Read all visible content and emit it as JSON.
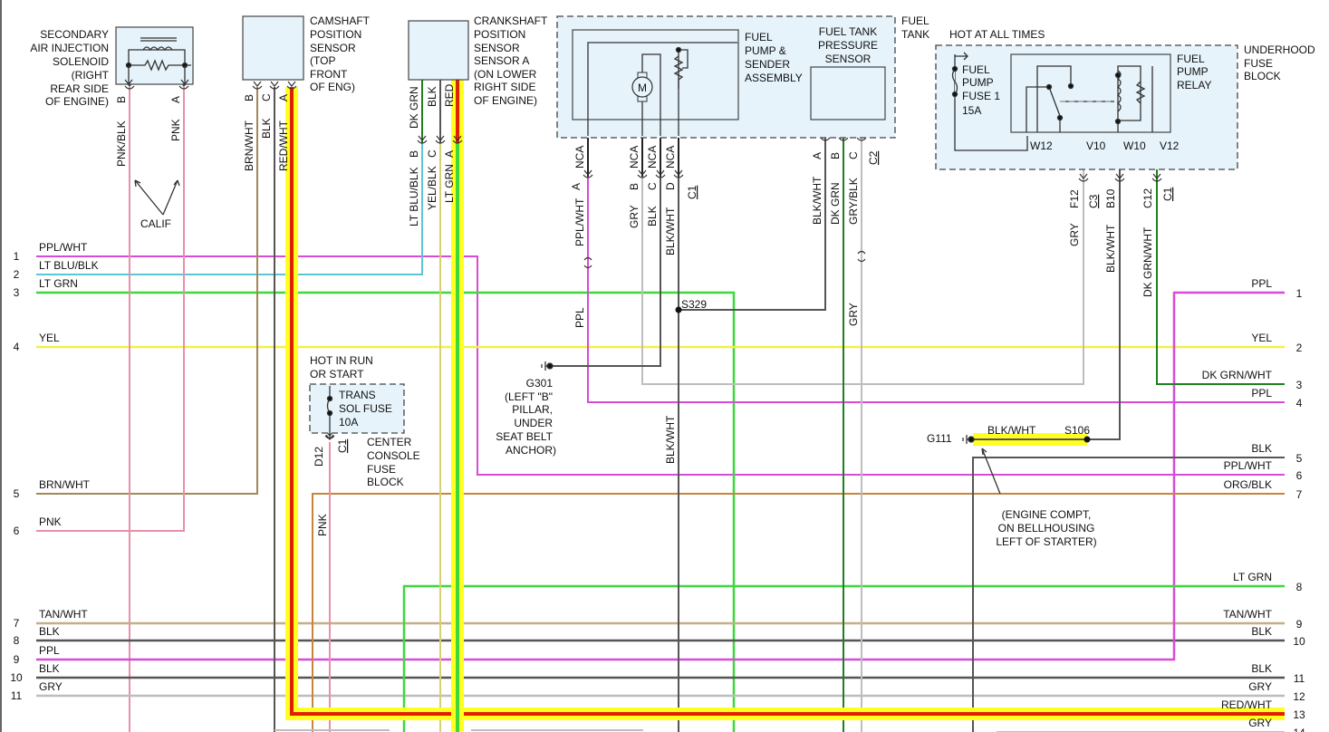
{
  "left_rows": [
    {
      "num": "1",
      "wire": "PPL/WHT"
    },
    {
      "num": "2",
      "wire": "LT BLU/BLK"
    },
    {
      "num": "3",
      "wire": "LT GRN"
    },
    {
      "num": "4",
      "wire": "YEL"
    },
    {
      "num": "5",
      "wire": "BRN/WHT"
    },
    {
      "num": "6",
      "wire": "PNK"
    },
    {
      "num": "7",
      "wire": "TAN/WHT"
    },
    {
      "num": "8",
      "wire": "BLK"
    },
    {
      "num": "9",
      "wire": "PPL"
    },
    {
      "num": "10",
      "wire": "BLK"
    },
    {
      "num": "11",
      "wire": "GRY"
    }
  ],
  "right_rows": [
    {
      "num": "1",
      "wire": "PPL"
    },
    {
      "num": "2",
      "wire": "YEL"
    },
    {
      "num": "3",
      "wire": "DK GRN/WHT"
    },
    {
      "num": "4",
      "wire": "PPL"
    },
    {
      "num": "5",
      "wire": "BLK"
    },
    {
      "num": "6",
      "wire": "PPL/WHT"
    },
    {
      "num": "7",
      "wire": "ORG/BLK"
    },
    {
      "num": "8",
      "wire": "LT GRN"
    },
    {
      "num": "9",
      "wire": "TAN/WHT"
    },
    {
      "num": "10",
      "wire": "BLK"
    },
    {
      "num": "11",
      "wire": "BLK"
    },
    {
      "num": "12",
      "wire": "GRY"
    },
    {
      "num": "13",
      "wire": "RED/WHT"
    },
    {
      "num": "14",
      "wire": "GRY"
    }
  ],
  "components": {
    "solenoid": {
      "label": [
        "SECONDARY",
        "AIR INJECTION",
        "SOLENOID",
        "(RIGHT",
        "REAR SIDE",
        "OF ENGINE)"
      ],
      "pins": [
        "B",
        "A"
      ],
      "wires": [
        "PNK/BLK",
        "PNK"
      ]
    },
    "calif": "CALIF",
    "camshaft": {
      "label": [
        "CAMSHAFT",
        "POSITION",
        "SENSOR",
        "(TOP",
        "FRONT",
        "OF ENG)"
      ],
      "pins": [
        "B",
        "C",
        "A"
      ],
      "wires": [
        "BRN/WHT",
        "BLK",
        "RED/WHT"
      ]
    },
    "crankshaft": {
      "label": [
        "CRANKSHAFT",
        "POSITION",
        "SENSOR",
        "SENSOR A",
        "(ON LOWER",
        "RIGHT SIDE",
        "OF ENGINE)"
      ],
      "top_wires": [
        "DK GRN",
        "BLK",
        "RED"
      ],
      "pins": [
        "B",
        "C",
        "A"
      ],
      "wires": [
        "LT BLU/BLK",
        "YEL/BLK",
        "LT GRN"
      ]
    },
    "fuel_tank": {
      "label": [
        "FUEL",
        "TANK"
      ]
    },
    "fuel_pump": {
      "label": [
        "FUEL",
        "PUMP &",
        "SENDER",
        "ASSEMBLY"
      ],
      "motor": "M",
      "nca": [
        "NCA",
        "NCA",
        "NCA",
        "NCA"
      ],
      "pins": [
        "A",
        "B",
        "C",
        "D"
      ],
      "connector": "C1",
      "wires": [
        "PPL/WHT",
        "GRY",
        "BLK",
        "BLK/WHT"
      ],
      "ppl": "PPL"
    },
    "pressure_sensor": {
      "label": [
        "FUEL TANK",
        "PRESSURE",
        "SENSOR"
      ],
      "pins": [
        "A",
        "B",
        "C"
      ],
      "connector": "C2",
      "wires": [
        "BLK/WHT",
        "DK GRN",
        "GRY/BLK"
      ],
      "gry": "GRY"
    },
    "hot_at_all_times": "HOT AT ALL TIMES",
    "underhood": {
      "label": [
        "UNDERHOOD",
        "FUSE",
        "BLOCK"
      ]
    },
    "fuse1": {
      "label": [
        "FUEL",
        "PUMP",
        "FUSE 1",
        "15A"
      ]
    },
    "relay": {
      "label": [
        "FUEL",
        "PUMP",
        "RELAY"
      ],
      "terminals": [
        "W12",
        "V10",
        "W10",
        "V12"
      ],
      "pins": [
        "F12",
        "B10",
        "C12"
      ],
      "connectors": [
        "C3",
        "C1"
      ],
      "wires": [
        "GRY",
        "BLK/WHT",
        "DK GRN/WHT"
      ]
    },
    "trans_fuse": {
      "hot": [
        "HOT IN RUN",
        "OR START"
      ],
      "label": [
        "TRANS",
        "SOL FUSE",
        "10A"
      ],
      "pin": "D12",
      "connector": "C1",
      "block": [
        "CENTER",
        "CONSOLE",
        "FUSE",
        "BLOCK"
      ],
      "wire": "PNK"
    },
    "s329": "S329",
    "g301": {
      "name": "G301",
      "label": [
        "(LEFT \"B\"",
        "PILLAR,",
        "UNDER",
        "SEAT BELT",
        "ANCHOR)"
      ]
    },
    "blk_wht_mid": "BLK/WHT",
    "g111": {
      "name": "G111",
      "wire": "BLK/WHT",
      "splice": "S106",
      "label": [
        "(ENGINE COMPT,",
        "ON BELLHOUSING",
        "LEFT OF STARTER)"
      ]
    }
  },
  "colors": {
    "ppl": "#d84ad8",
    "lt_blu": "#5cc6d6",
    "lt_grn": "#3ed83e",
    "yel": "#f2f04a",
    "brn": "#a08858",
    "pnk": "#e890a8",
    "tan": "#c4ae88",
    "blk": "#555555",
    "gry": "#bdbdbd",
    "org": "#c8843c",
    "dk_grn": "#1f7f1f",
    "red": "#e02000",
    "highlight": "#ffff20"
  }
}
